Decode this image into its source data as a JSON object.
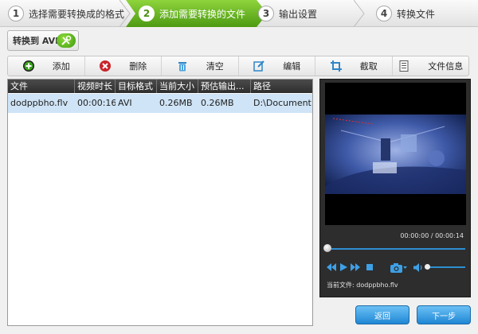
{
  "steps": [
    {
      "num": "1",
      "label": "选择需要转换成的格式"
    },
    {
      "num": "2",
      "label": "添加需要转换的文件"
    },
    {
      "num": "3",
      "label": "输出设置"
    },
    {
      "num": "4",
      "label": "转换文件"
    }
  ],
  "active_step": 2,
  "convert_to_label": "转换到 AVI",
  "toolbar": {
    "add": "添加",
    "delete": "删除",
    "clear": "清空",
    "edit": "编辑",
    "crop": "截取",
    "file_info": "文件信息"
  },
  "table": {
    "headers": [
      "文件",
      "视频时长",
      "目标格式",
      "当前大小",
      "预估输出...",
      "路径"
    ],
    "rows": [
      [
        "dodppbho.flv",
        "00:00:16",
        "AVI",
        "0.26MB",
        "0.26MB",
        "D:\\Document..."
      ]
    ]
  },
  "player": {
    "time": "00:00:00 / 00:00:14",
    "current_file": "当前文件: dodppbho.flv"
  },
  "buttons": {
    "back": "返回",
    "next": "下一步"
  },
  "colors": {
    "active_step": "#5aa41a",
    "accent_blue": "#1f86d4",
    "row_selected": "#cfe4f6"
  }
}
